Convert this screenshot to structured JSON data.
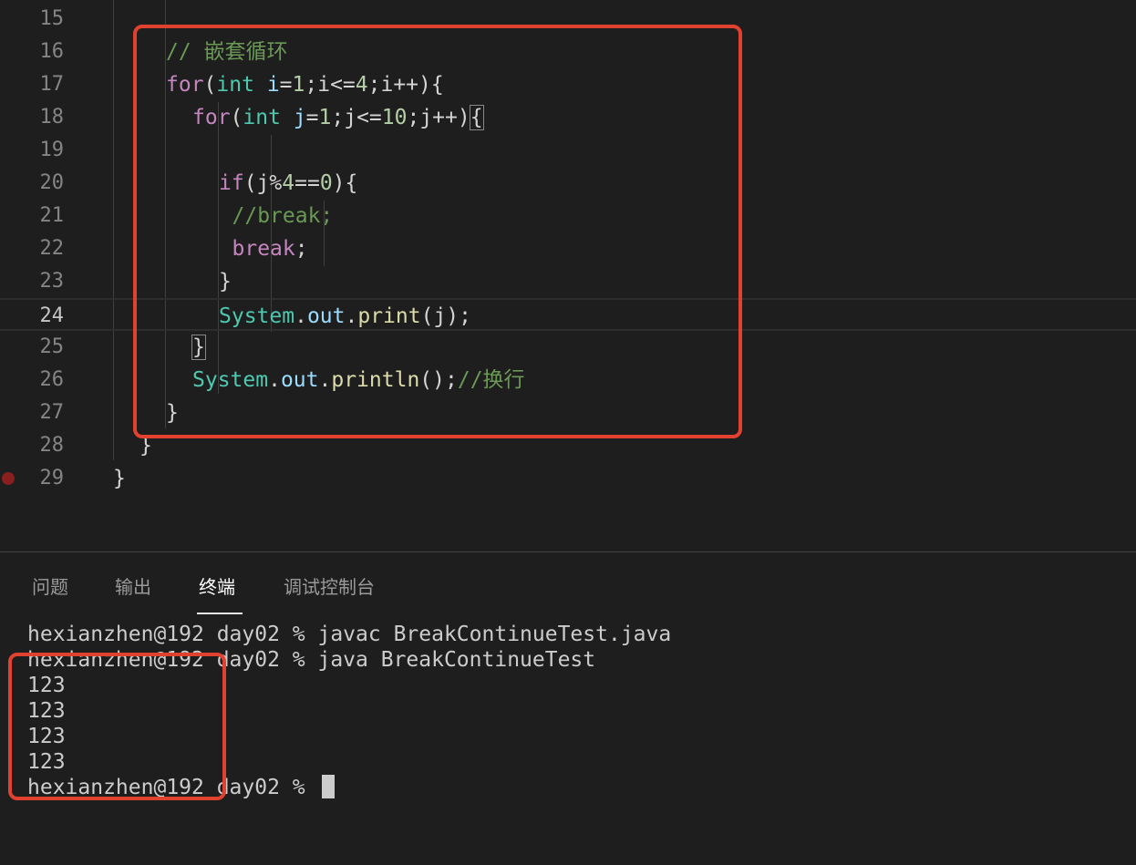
{
  "editor": {
    "lines": [
      {
        "num": "15",
        "indent": 0,
        "tokens": []
      },
      {
        "num": "16",
        "indent": 4,
        "tokens": [
          {
            "t": "// 嵌套循环",
            "c": "c-com"
          }
        ]
      },
      {
        "num": "17",
        "indent": 4,
        "tokens": [
          {
            "t": "for",
            "c": "c-kw"
          },
          {
            "t": "(",
            "c": "c-plain"
          },
          {
            "t": "int",
            "c": "c-type"
          },
          {
            "t": " ",
            "c": "c-plain"
          },
          {
            "t": "i",
            "c": "c-var"
          },
          {
            "t": "=",
            "c": "c-plain"
          },
          {
            "t": "1",
            "c": "c-num"
          },
          {
            "t": ";i<=",
            "c": "c-plain"
          },
          {
            "t": "4",
            "c": "c-num"
          },
          {
            "t": ";i++){",
            "c": "c-plain"
          }
        ]
      },
      {
        "num": "18",
        "indent": 6,
        "tokens": [
          {
            "t": "for",
            "c": "c-kw"
          },
          {
            "t": "(",
            "c": "c-plain"
          },
          {
            "t": "int",
            "c": "c-type"
          },
          {
            "t": " ",
            "c": "c-plain"
          },
          {
            "t": "j",
            "c": "c-var"
          },
          {
            "t": "=",
            "c": "c-plain"
          },
          {
            "t": "1",
            "c": "c-num"
          },
          {
            "t": ";j<=",
            "c": "c-plain"
          },
          {
            "t": "10",
            "c": "c-num"
          },
          {
            "t": ";j++)",
            "c": "c-plain"
          },
          {
            "t": "{",
            "c": "c-plain bracket-box"
          }
        ]
      },
      {
        "num": "19",
        "indent": 0,
        "tokens": []
      },
      {
        "num": "20",
        "indent": 8,
        "tokens": [
          {
            "t": "if",
            "c": "c-kw"
          },
          {
            "t": "(j%",
            "c": "c-plain"
          },
          {
            "t": "4",
            "c": "c-num"
          },
          {
            "t": "==",
            "c": "c-plain"
          },
          {
            "t": "0",
            "c": "c-num"
          },
          {
            "t": "){",
            "c": "c-plain"
          }
        ]
      },
      {
        "num": "21",
        "indent": 9,
        "tokens": [
          {
            "t": "//break;",
            "c": "c-com"
          }
        ]
      },
      {
        "num": "22",
        "indent": 9,
        "tokens": [
          {
            "t": "break",
            "c": "c-kw"
          },
          {
            "t": ";",
            "c": "c-plain"
          }
        ]
      },
      {
        "num": "23",
        "indent": 8,
        "tokens": [
          {
            "t": "}",
            "c": "c-plain"
          }
        ]
      },
      {
        "num": "24",
        "indent": 8,
        "current": true,
        "tokens": [
          {
            "t": "System",
            "c": "c-cls"
          },
          {
            "t": ".",
            "c": "c-plain"
          },
          {
            "t": "out",
            "c": "c-var"
          },
          {
            "t": ".",
            "c": "c-plain"
          },
          {
            "t": "print",
            "c": "c-fn"
          },
          {
            "t": "(j);",
            "c": "c-plain"
          }
        ]
      },
      {
        "num": "25",
        "indent": 6,
        "tokens": [
          {
            "t": "}",
            "c": "c-plain bracket-box"
          }
        ]
      },
      {
        "num": "26",
        "indent": 6,
        "tokens": [
          {
            "t": "System",
            "c": "c-cls"
          },
          {
            "t": ".",
            "c": "c-plain"
          },
          {
            "t": "out",
            "c": "c-var"
          },
          {
            "t": ".",
            "c": "c-plain"
          },
          {
            "t": "println",
            "c": "c-fn"
          },
          {
            "t": "();",
            "c": "c-plain"
          },
          {
            "t": "//换行",
            "c": "c-com"
          }
        ]
      },
      {
        "num": "27",
        "indent": 4,
        "tokens": [
          {
            "t": "}",
            "c": "c-plain"
          }
        ]
      },
      {
        "num": "28",
        "indent": 2,
        "tokens": [
          {
            "t": "}",
            "c": "c-plain"
          }
        ]
      },
      {
        "num": "29",
        "indent": 0,
        "breakpoint": true,
        "tokens": [
          {
            "t": "}",
            "c": "c-plain"
          }
        ]
      }
    ]
  },
  "panel": {
    "tabs": [
      {
        "label": "问题",
        "active": false
      },
      {
        "label": "输出",
        "active": false
      },
      {
        "label": "终端",
        "active": true
      },
      {
        "label": "调试控制台",
        "active": false
      }
    ],
    "terminal": [
      "hexianzhen@192 day02 % javac BreakContinueTest.java",
      "hexianzhen@192 day02 % java BreakContinueTest",
      "123",
      "123",
      "123",
      "123",
      "hexianzhen@192 day02 % "
    ]
  },
  "colors": {
    "highlight_box": "#e0422f",
    "background": "#1e1e1e"
  }
}
